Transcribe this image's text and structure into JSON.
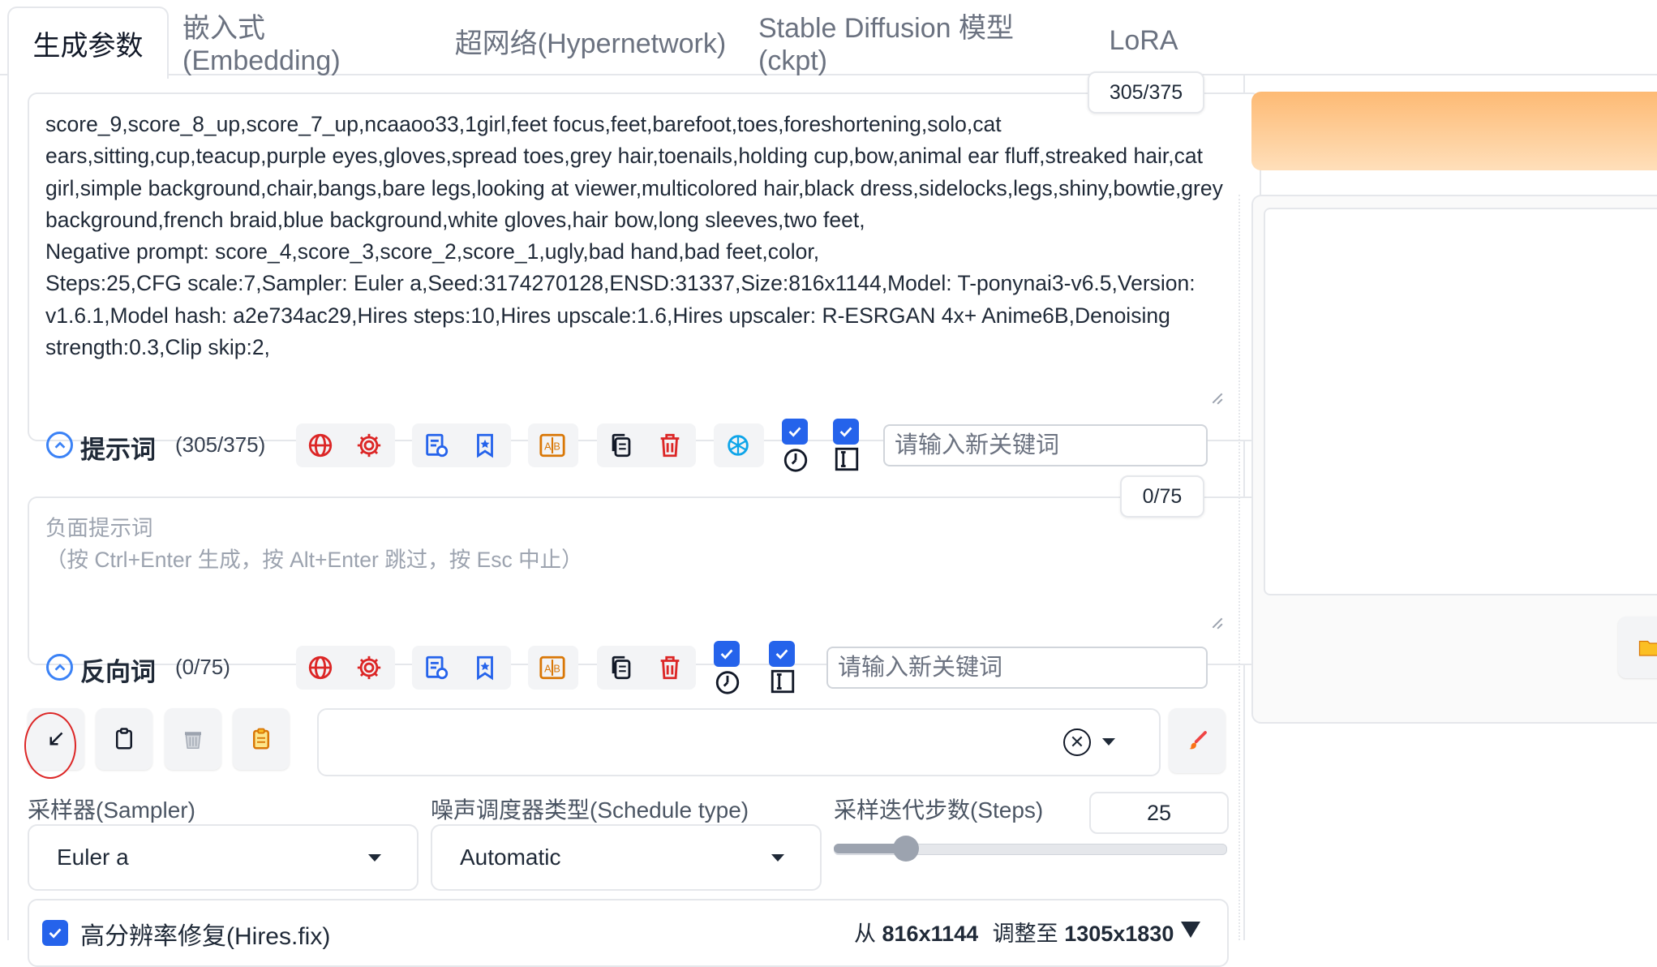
{
  "tabs": [
    {
      "label": "生成参数"
    },
    {
      "label": "嵌入式(Embedding)"
    },
    {
      "label": "超网络(Hypernetwork)"
    },
    {
      "label": "Stable Diffusion 模型(ckpt)"
    },
    {
      "label": "LoRA"
    }
  ],
  "prompt": {
    "counter": "305/375",
    "text": "score_9,score_8_up,score_7_up,ncaaoo33,1girl,feet focus,feet,barefoot,toes,foreshortening,solo,cat ears,sitting,cup,teacup,purple eyes,gloves,spread toes,grey hair,toenails,holding cup,bow,animal ear fluff,streaked hair,cat girl,simple background,chair,bangs,bare legs,looking at viewer,multicolored hair,black dress,sidelocks,legs,shiny,bowtie,grey background,french braid,blue background,white gloves,hair bow,long sleeves,two feet,\nNegative prompt: score_4,score_3,score_2,score_1,ugly,bad hand,bad feet,color,\nSteps:25,CFG scale:7,Sampler: Euler a,Seed:3174270128,ENSD:31337,Size:816x1144,Model: T-ponynai3-v6.5,Version: v1.6.1,Model hash: a2e734ac29,Hires steps:10,Hires upscale:1.6,Hires upscaler: R-ESRGAN 4x+ Anime6B,Denoising strength:0.3,Clip skip:2,",
    "label": "提示词",
    "count": "(305/375)",
    "keyword_placeholder": "请输入新关键词"
  },
  "negative": {
    "counter": "0/75",
    "placeholder": "负面提示词\n（按 Ctrl+Enter 生成，按 Alt+Enter 跳过，按 Esc 中止）",
    "label": "反向词",
    "count": "(0/75)",
    "keyword_placeholder": "请输入新关键词"
  },
  "sampler": {
    "label": "采样器(Sampler)",
    "value": "Euler a"
  },
  "schedule": {
    "label": "噪声调度器类型(Schedule type)",
    "value": "Automatic"
  },
  "steps": {
    "label": "采样迭代步数(Steps)",
    "value": "25",
    "min": 1,
    "max": 150
  },
  "hires": {
    "label": "高分辨率修复(Hires.fix)",
    "from_prefix": "从",
    "from_size": "816x1144",
    "to_prefix": "调整至",
    "to_size": "1305x1830",
    "checked": true
  },
  "colors": {
    "accent_blue": "#2563eb",
    "generate_orange": "#fdba74",
    "red_icon": "#dc2626",
    "blue_icon": "#2563eb",
    "orange_icon": "#d97706"
  }
}
